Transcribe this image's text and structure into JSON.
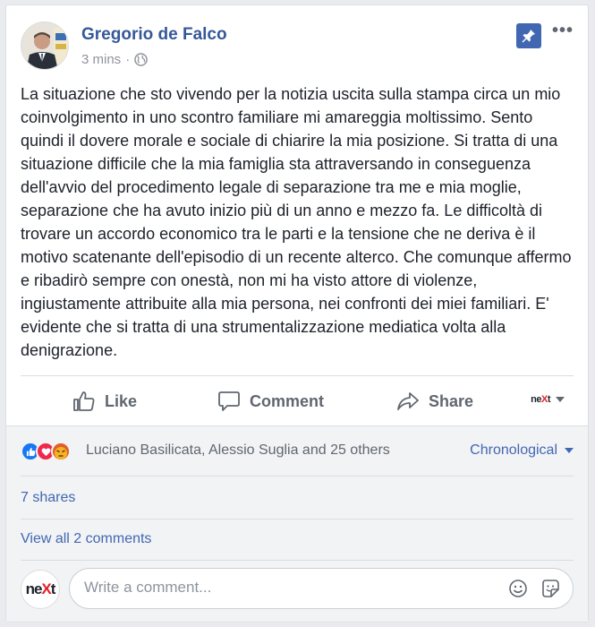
{
  "post": {
    "author": "Gregorio de Falco",
    "time": "3 mins",
    "meta_sep": "·",
    "more": "•••",
    "text": "La situazione che sto vivendo per la notizia uscita sulla stampa circa un mio coinvolgimento in uno scontro familiare mi amareggia moltissimo. Sento quindi il dovere morale e sociale di chiarire la mia posizione. Si tratta di una situazione difficile che la mia famiglia sta attraversando in conseguenza dell'avvio del procedimento legale di separazione tra me e mia moglie, separazione che ha avuto inizio più di un anno e mezzo fa. Le difficoltà di trovare un accordo economico tra le parti e la tensione che ne deriva è il motivo scatenante dell'episodio di un recente alterco. Che comunque affermo e ribadirò sempre con onestà, non mi ha visto attore di violenze, ingiustamente attribuite alla mia persona, nei confronti dei miei familiari. E' evidente che si tratta di una strumentalizzazione mediatica volta alla denigrazione."
  },
  "actions": {
    "like": "Like",
    "comment": "Comment",
    "share": "Share",
    "page_ne": "ne",
    "page_x": "X",
    "page_t": "t"
  },
  "footer": {
    "reactions_names": "Luciano Basilicata, Alessio Suglia and 25 others",
    "sort": "Chronological",
    "shares": "7 shares",
    "view_comments": "View all 2 comments",
    "comment_placeholder": "Write a comment...",
    "avatar_ne": "ne",
    "avatar_x": "X",
    "avatar_t": "t"
  },
  "colors": {
    "link": "#4267b2",
    "author": "#365899",
    "like": "#1877f2",
    "love": "#f0284a",
    "angry": "#f7b125",
    "brand_x": "#e41e26"
  }
}
